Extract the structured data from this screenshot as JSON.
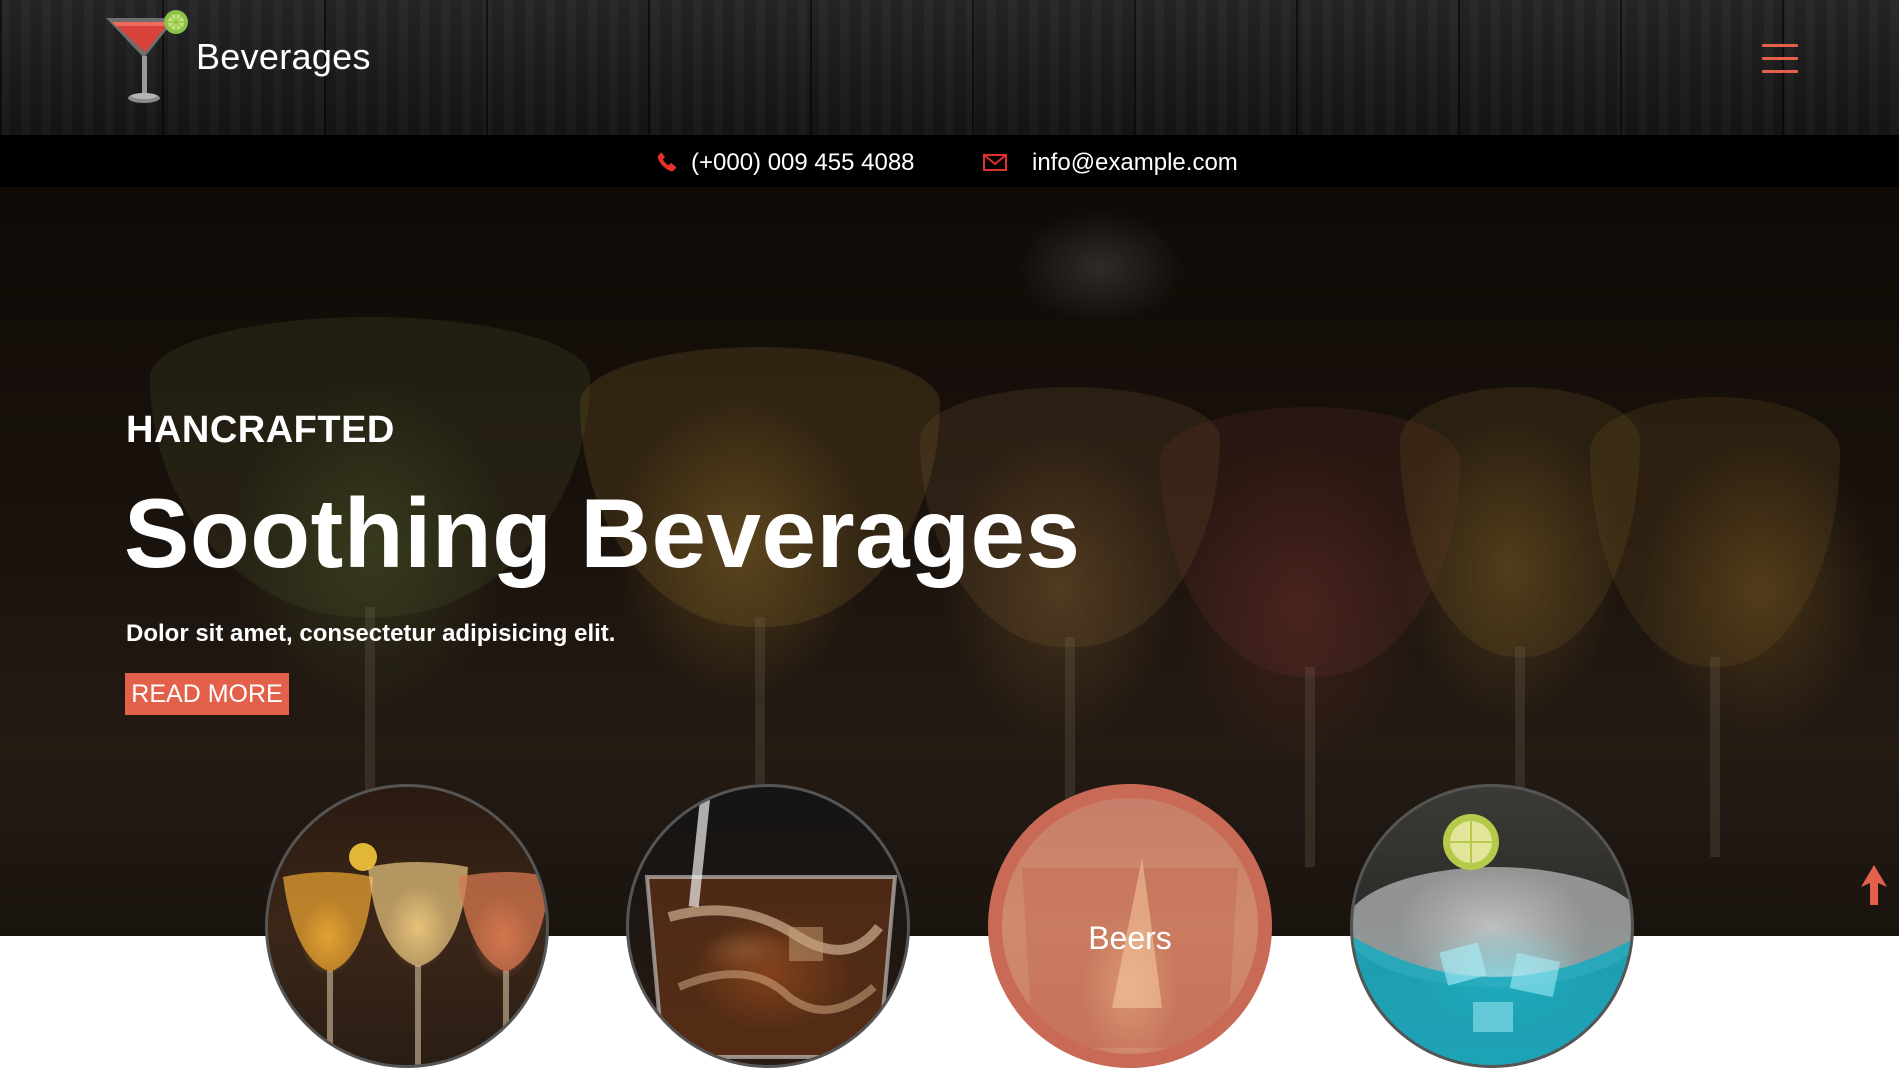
{
  "brand": {
    "name": "Beverages",
    "logo_icon": "cocktail-glass-icon"
  },
  "header": {
    "menu_icon": "hamburger-menu-icon"
  },
  "contact": {
    "phone": "(+000) 009 455 4088",
    "email": "info@example.com",
    "phone_icon": "phone-icon",
    "email_icon": "envelope-icon"
  },
  "hero": {
    "kicker": "HANCRAFTED",
    "title": "Soothing Beverages",
    "subtitle": "Dolor sit amet, consectetur adipisicing elit.",
    "cta_label": "READ MORE"
  },
  "categories": [
    {
      "label": ""
    },
    {
      "label": ""
    },
    {
      "label": "Beers"
    },
    {
      "label": ""
    }
  ],
  "colors": {
    "accent": "#e3604a",
    "contact_bar": "#000000",
    "hover_ring": "#c96a57"
  },
  "scroll_top_icon": "arrow-up-icon"
}
